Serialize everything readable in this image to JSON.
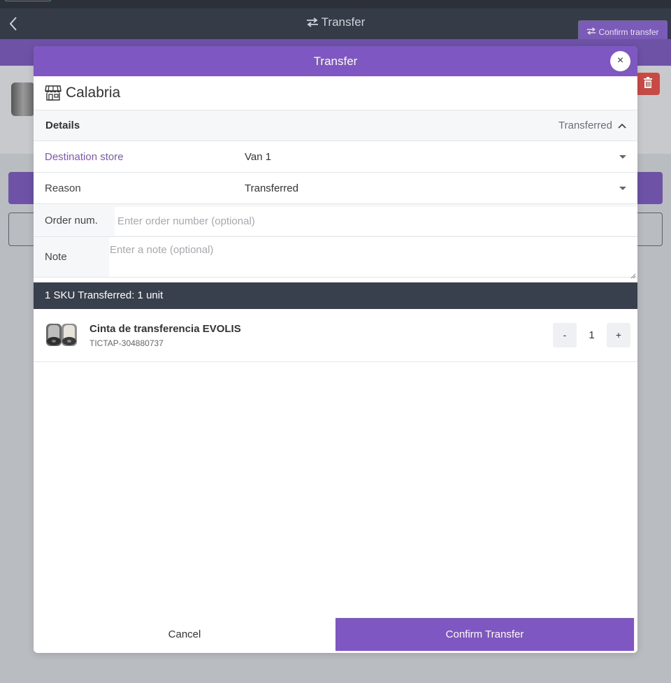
{
  "app": {
    "title": "Transfer",
    "confirm_label": "Confirm transfer"
  },
  "modal": {
    "title": "Transfer",
    "close_label": "×",
    "store_name": "Calabria",
    "details": {
      "label": "Details",
      "status": "Transferred"
    },
    "destination": {
      "label": "Destination store",
      "value": "Van 1"
    },
    "reason": {
      "label": "Reason",
      "value": "Transferred"
    },
    "order": {
      "label": "Order num.",
      "placeholder": "Enter order number (optional)"
    },
    "note": {
      "label": "Note",
      "placeholder": "Enter a note (optional)"
    },
    "summary": "1 SKU Transferred: 1 unit",
    "items": [
      {
        "name": "Cinta de transferencia EVOLIS",
        "sku": "TICTAP-304880737",
        "quantity": "1",
        "minus_label": "-",
        "plus_label": "+"
      }
    ],
    "cancel_label": "Cancel",
    "confirm_label": "Confirm Transfer"
  },
  "colors": {
    "accent": "#7e57c2",
    "header_dark": "#353c48",
    "summary_bar": "#383f4d",
    "danger": "#c94a45"
  }
}
